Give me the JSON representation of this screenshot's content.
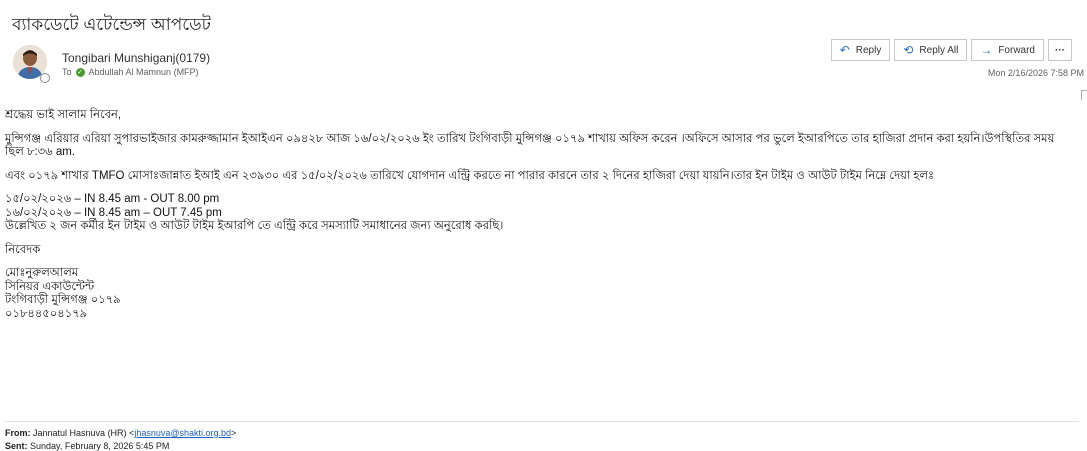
{
  "subject": "ব্যাকডেটে এটেন্ডেন্স আপডেট",
  "sender": "Tongibari Munshiganj(0179)",
  "to_label": "To",
  "recipient": "Abdullah Al Mamnun (MFP)",
  "avatar_icon": "person-avatar-icon",
  "actions": {
    "reply": "Reply",
    "reply_all": "Reply All",
    "forward": "Forward",
    "more": "···"
  },
  "icons": {
    "reply": "reply-arrow-icon",
    "reply_all": "reply-all-arrow-icon",
    "forward": "forward-arrow-icon"
  },
  "date": "Mon 2/16/2026 7:58 PM",
  "body": {
    "greeting": "শ্রদ্ধেয় ভাই সালাম নিবেন,",
    "para1": "মুন্সিগঞ্জ এরিয়ার এরিয়া সুপারভাইজার কামরুজ্জামান ইআইএন ০৯৪২৮ আজ ১৬/০২/২০২৬ ইং তারিখ টংগিবাড়ী মুন্সিগঞ্জ ০১৭৯ শাখায় অফিস করেন ।অফিসে আসার পর ভুলে ইআরপিতে তার হাজিরা প্রদান করা হয়নি।উপস্থিতির সময় ছিল ৮:৩৬ am.",
    "para2": "এবং ০১৭৯ শাখার TMFO মোসাঃজান্নাত ইআই এন ২৩৯৩০ এর ১৫/০২/২০২৬ তারিখে যোগদান এন্ট্রি করতে না পারার কারনে তার ২ দিনের হাজিরা দেয়া যায়নি।তার ইন টাইম ও আউট টাইম নিম্নে দেয়া হলঃ",
    "time1": "১৫/০২/২০২৬ – IN 8.45 am -  OUT 8.00 pm",
    "time2": "১৬/০২/২০২৬ – IN 8.45 am – OUT 7.45 pm",
    "request": "উল্লেখিত ২ জন কর্মীর ইন টাইম ও আউট টাইম ইআরপি তে এন্ট্রি করে সমস্যাটি সমাধানের জন্য অনুরোধ করছি।",
    "closing": "নিবেদক",
    "sig_name": "মোঃনুরুলআলম",
    "sig_title": "সিনিয়র একাউন্টেন্ট",
    "sig_branch": "টংগিবাড়ী মুন্সিগঞ্জ ০১৭৯",
    "sig_phone": "০১৮৪৪৫০৪১৭৯"
  },
  "forwarded": {
    "from_label": "From:",
    "from_name": "Jannatul Hasnuva (HR) <",
    "from_email": "jhasnuva@shakti.org.bd",
    "from_end": ">",
    "sent_label": "Sent:",
    "sent_value": "Sunday, February 8, 2026 5:45 PM"
  }
}
